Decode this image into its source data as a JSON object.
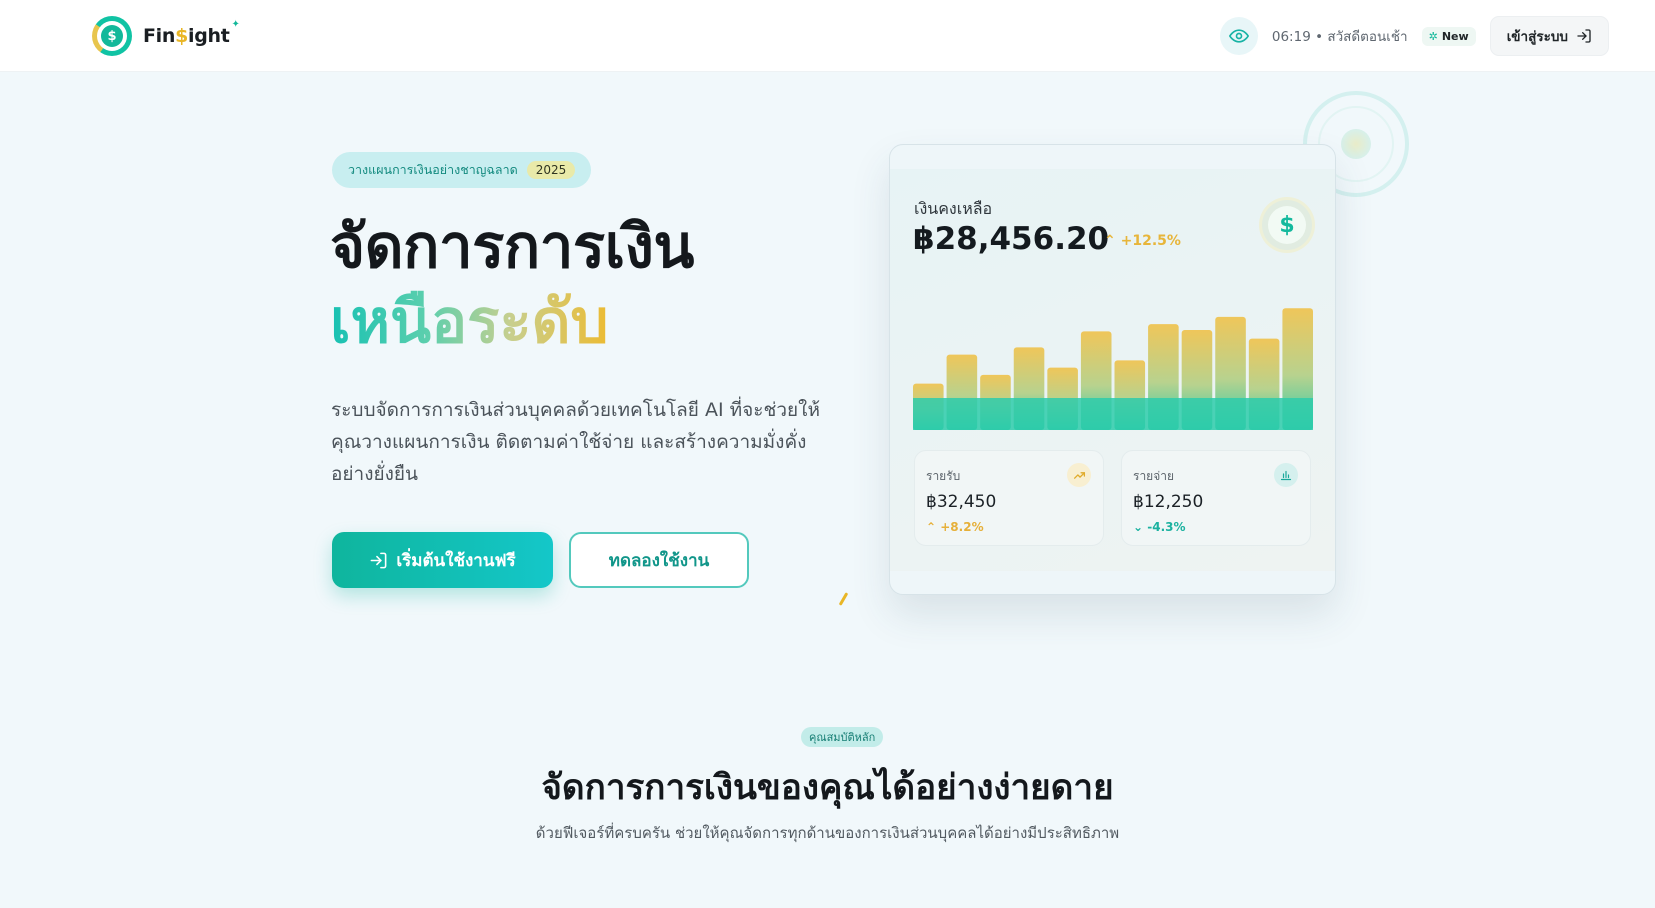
{
  "header": {
    "logo_prefix": "Fin",
    "logo_accent": "$",
    "logo_suffix": "ight",
    "greeting": "06:19 • สวัสดีตอนเช้า",
    "new_badge": "New",
    "login_label": "เข้าสู่ระบบ"
  },
  "hero": {
    "pill_text": "วางแผนการเงินอย่างชาญฉลาด",
    "pill_year": "2025",
    "title_line1": "จัดการการเงิน",
    "title_line2": "เหนือระดับ",
    "description": "ระบบจัดการการเงินส่วนบุคคลด้วยเทคโนโลยี AI ที่จะช่วยให้คุณวางแผนการเงิน ติดตามค่าใช้จ่าย และสร้างความมั่งคั่งอย่างยั่งยืน",
    "cta_primary": "เริ่มต้นใช้งานฟรี",
    "cta_secondary": "ทดลองใช้งาน"
  },
  "card": {
    "balance_label": "เงินคงเหลือ",
    "balance_value": "฿28,456.20",
    "balance_change": "+12.5%",
    "bars": [
      0.32,
      0.52,
      0.38,
      0.57,
      0.43,
      0.68,
      0.48,
      0.73,
      0.69,
      0.78,
      0.63,
      0.84
    ],
    "income_label": "รายรับ",
    "income_value": "฿32,450",
    "income_change": "+8.2%",
    "expense_label": "รายจ่าย",
    "expense_value": "฿12,250",
    "expense_change": "-4.3%",
    "colors": {
      "bar_top": "#efc65a",
      "bar_bottom": "#2ecbaa"
    }
  },
  "features": {
    "pill": "คุณสมบัติหลัก",
    "title": "จัดการการเงินของคุณได้อย่างง่ายดาย",
    "subtitle": "ด้วยฟีเจอร์ที่ครบครัน ช่วยให้คุณจัดการทุกด้านของการเงินส่วนบุคคลได้อย่างมีประสิทธิภาพ"
  }
}
